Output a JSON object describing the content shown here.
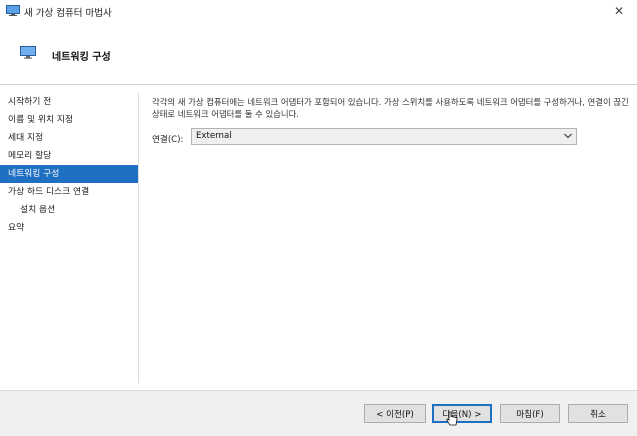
{
  "window": {
    "title": "새 가상 컴퓨터 마법사",
    "close_label": "✕"
  },
  "header": {
    "title": "네트워킹 구성",
    "icon": "monitor-icon"
  },
  "sidebar": {
    "items": [
      {
        "label": "시작하기 전"
      },
      {
        "label": "이름 및 위치 지정"
      },
      {
        "label": "세대 지정"
      },
      {
        "label": "메모리 할당"
      },
      {
        "label": "네트워킹 구성"
      },
      {
        "label": "가상 하드 디스크 연결"
      },
      {
        "label": "설치 옵션"
      },
      {
        "label": "요약"
      }
    ]
  },
  "main": {
    "description": "각각의 새 가상 컴퓨터에는 네트워크 어댑터가 포함되어 있습니다. 가상 스위치를 사용하도록 네트워크 어댑터를 구성하거나, 연결이 끊긴 상태로 네트워크 어댑터를 둘 수 있습니다.",
    "connection_label": "연결(C):",
    "connection_value": "External"
  },
  "footer": {
    "prev_label": "< 이전(P)",
    "next_label": "다음(N) >",
    "finish_label": "마침(F)",
    "cancel_label": "취소"
  },
  "colors": {
    "accent": "#1f6fc3",
    "footer_bg": "#f0f0f0"
  }
}
